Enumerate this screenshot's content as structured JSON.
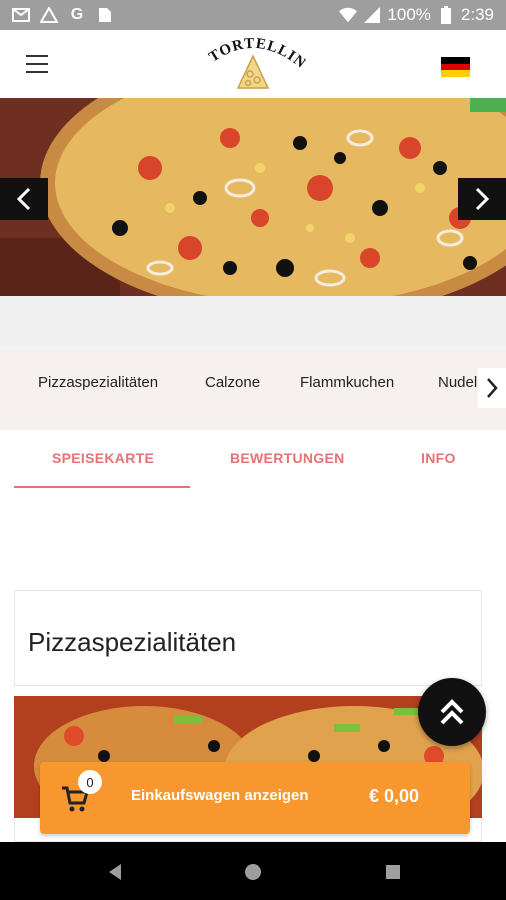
{
  "status_bar": {
    "battery": "100%",
    "time": "2:39",
    "icons": [
      "gmail-icon",
      "drive-icon",
      "google-icon",
      "sim-icon",
      "wifi-icon",
      "signal-icon",
      "battery-icon"
    ]
  },
  "header": {
    "logo_text": "TORTELLINO",
    "menu_icon": "hamburger-icon",
    "language_flag": "german-flag"
  },
  "hero": {
    "prev_icon": "chevron-left-icon",
    "next_icon": "chevron-right-icon"
  },
  "categories": [
    {
      "label": "Pizzaspezialitäten"
    },
    {
      "label": "Calzone"
    },
    {
      "label": "Flammkuchen"
    },
    {
      "label": "Nudel"
    }
  ],
  "tabs": [
    {
      "label": "SPEISEKARTE",
      "active": true
    },
    {
      "label": "BEWERTUNGEN",
      "active": false
    },
    {
      "label": "INFO",
      "active": false
    }
  ],
  "section": {
    "title": "Pizzaspezialitäten"
  },
  "cart": {
    "count": "0",
    "label": "Einkaufswagen anzeigen",
    "total": "€ 0,00"
  },
  "colors": {
    "accent": "#e57373",
    "cart": "#f7972e",
    "status_bar": "#9e9e9e"
  }
}
